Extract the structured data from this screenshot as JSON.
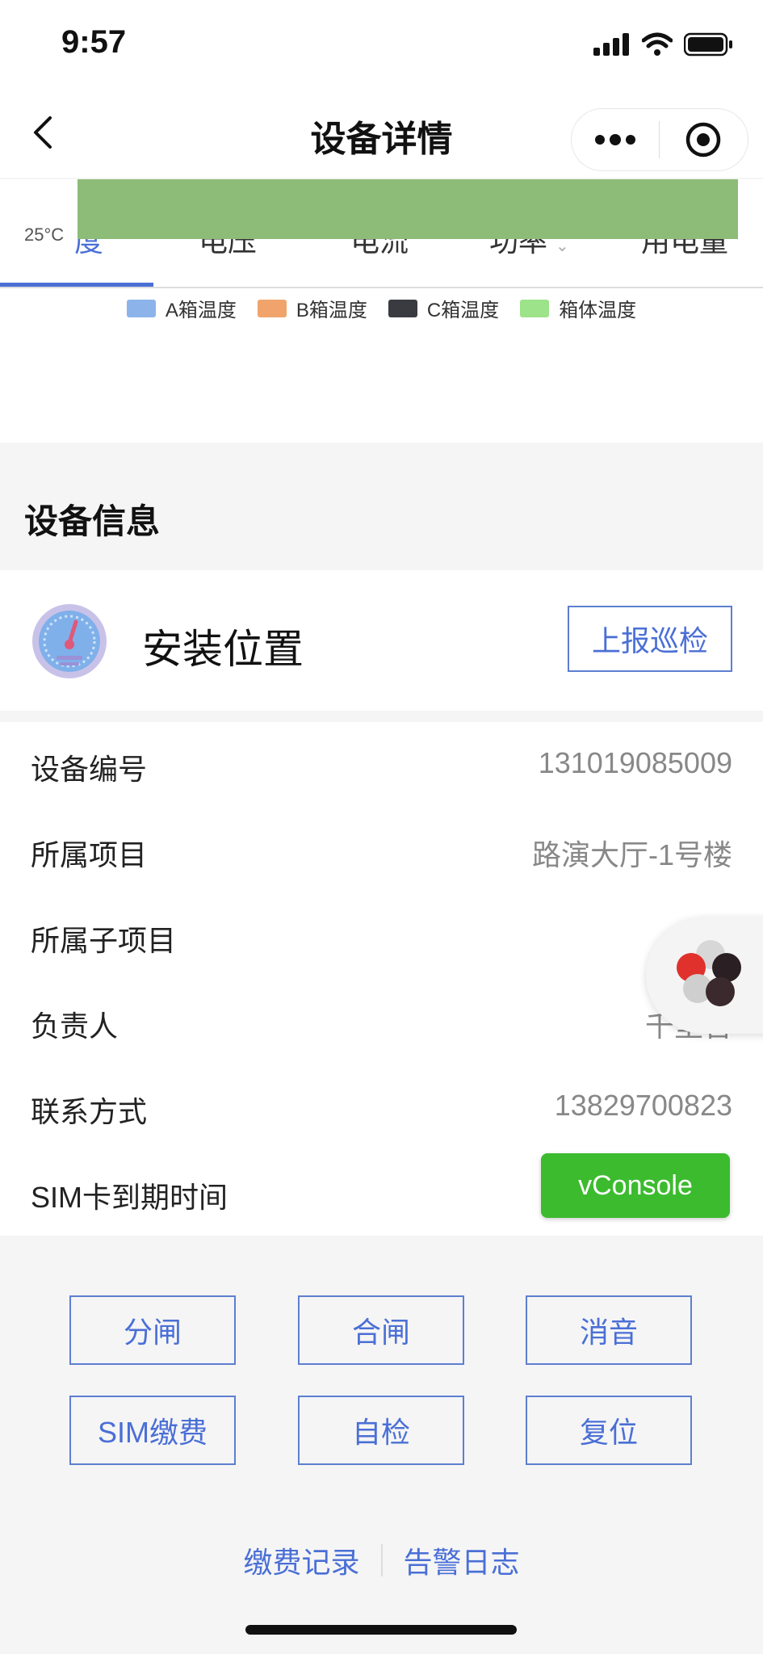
{
  "status_bar": {
    "time": "9:57"
  },
  "nav": {
    "title": "设备详情"
  },
  "tabs": {
    "items": [
      "度",
      "电压",
      "电流",
      "功率",
      "用电量"
    ],
    "temp_label": "25°C"
  },
  "legend": [
    {
      "label": "A箱温度",
      "color": "#8cb4ea"
    },
    {
      "label": "B箱温度",
      "color": "#f0a46c"
    },
    {
      "label": "C箱温度",
      "color": "#3a3b40"
    },
    {
      "label": "箱体温度",
      "color": "#9de38a"
    }
  ],
  "section": {
    "title": "设备信息"
  },
  "install": {
    "title": "安装位置",
    "report_button": "上报巡检"
  },
  "info_rows": [
    {
      "key": "设备编号",
      "value": "131019085009"
    },
    {
      "key": "所属项目",
      "value": "路演大厅-1号楼"
    },
    {
      "key": "所属子项目",
      "value": ""
    },
    {
      "key": "负责人",
      "value": "千里官"
    },
    {
      "key": "联系方式",
      "value": "13829700823"
    },
    {
      "key": "SIM卡到期时间",
      "value": ""
    }
  ],
  "vconsole": {
    "label": "vConsole"
  },
  "actions": [
    "分闸",
    "合闸",
    "消音",
    "SIM缴费",
    "自检",
    "复位"
  ],
  "footer": {
    "link1": "缴费记录",
    "link2": "告警日志"
  },
  "colors": {
    "accent": "#4a6fd6",
    "vconsole": "#3cbb2f"
  }
}
